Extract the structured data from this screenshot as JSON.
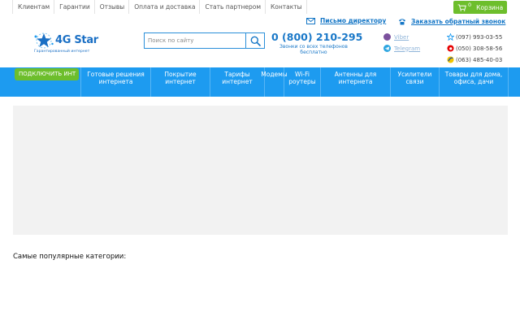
{
  "top_links": [
    "Клиентам",
    "Гарантии",
    "Отзывы",
    "Оплата и доставка",
    "Стать партнером",
    "Контакты"
  ],
  "cart": {
    "count": "0",
    "label": "Корзина"
  },
  "header": {
    "director_link": "Письмо директору",
    "callback_link": "Заказать обратный звонок"
  },
  "logo": {
    "name": "4G Star",
    "tagline": "Гарантированный интернет"
  },
  "search": {
    "placeholder": "Поиск по сайту"
  },
  "hotline": {
    "phone": "0 (800) 210-295",
    "note": "Звонки со всех телефонов бесплатно"
  },
  "messengers": [
    {
      "label": "Viber",
      "icon": "viber-icon",
      "color": "#7b519d"
    },
    {
      "label": "Telegram",
      "icon": "telegram-icon",
      "color": "#2ca5e0"
    }
  ],
  "operators": [
    {
      "phone": "(097) 993-03-55",
      "icon": "kyivstar-icon"
    },
    {
      "phone": "(050) 308-58-56",
      "icon": "vodafone-icon"
    },
    {
      "phone": "(063) 485-40-03",
      "icon": "lifecell-icon"
    }
  ],
  "nav": {
    "cta": "ПОДКЛЮЧИТЬ ИНТ",
    "items": [
      "Готовые решения интернета",
      "Покрытие интернет",
      "Тарифы интернет",
      "Модемы",
      "Wi-Fi роутеры",
      "Антенны для интернета",
      "Усилители связи",
      "Товары для дома, офиса, дачи"
    ]
  },
  "main": {
    "popular_title": "Самые популярные категории:"
  },
  "colors": {
    "accent_blue": "#1d9bf0",
    "accent_green": "#6dbe2c",
    "link_blue": "#1476c6"
  }
}
